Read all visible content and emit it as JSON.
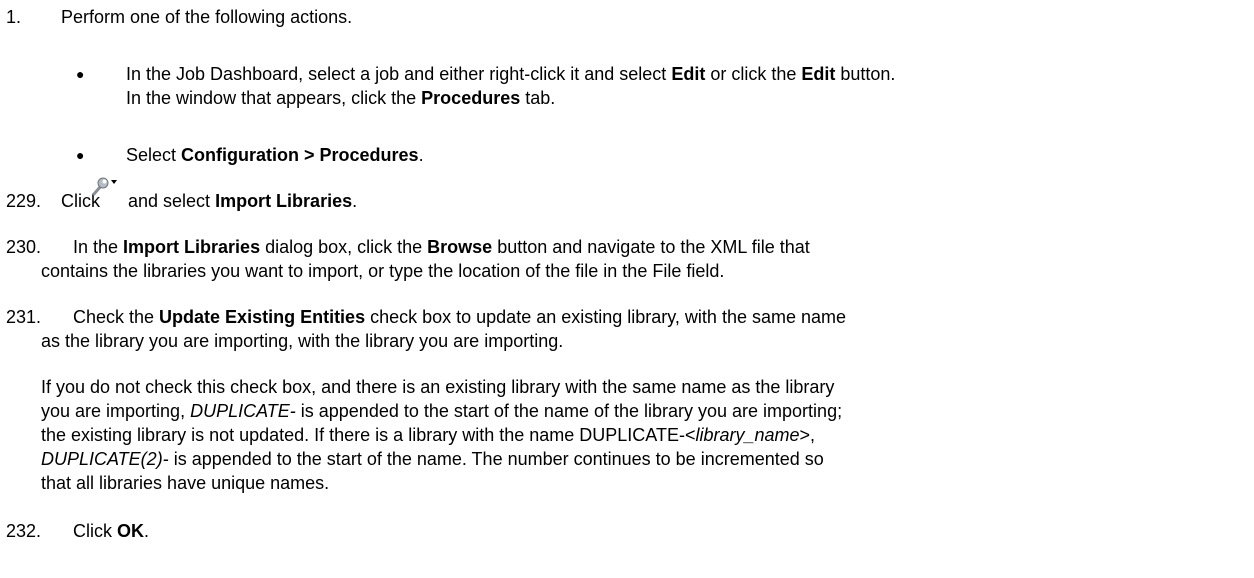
{
  "steps": {
    "s1": {
      "number": "1.",
      "text": "Perform one of the following actions.",
      "bullets": {
        "b1": {
          "line1": {
            "t1": "In the Job Dashboard, select a job and either right-click it and select ",
            "b1": "Edit",
            "t2": " or click the ",
            "b2": "Edit",
            "t3": " button."
          },
          "line2": {
            "t1": "In the window that appears, click the ",
            "b1": "Procedures",
            "t2": " tab."
          }
        },
        "b2": {
          "t1": "Select ",
          "b1": "Configuration > Procedures",
          "t2": "."
        }
      }
    },
    "s229": {
      "number": "229.",
      "t1": "Click",
      "t2": " and select ",
      "b1": "Import Libraries",
      "t3": "."
    },
    "s230": {
      "number": "230.",
      "line1": {
        "t1": "In the ",
        "b1": "Import Libraries",
        "t2": " dialog box, click the ",
        "b2": "Browse",
        "t3": " button and navigate to the XML file that"
      },
      "line2": "contains the libraries you want to import,   or type the location of the file in the File field."
    },
    "s231": {
      "number": "231.",
      "line1": {
        "t1": "Check the ",
        "b1": "Update Existing Entities",
        "t2": " check box to update an existing library, with the same name"
      },
      "line2": "as   the library you are importing, with the library you are importing.",
      "para": {
        "line1": "If you do not check this check box, and there is an existing library with the same name as the library",
        "line2": {
          "t1": "you are importing, ",
          "i1": "DUPLICATE-",
          "t2": " is appended to the start of the name of the library you are importing;"
        },
        "line3": {
          "t1": "the existing library is not updated. If there is a library with the name DUPLICATE-<",
          "i1": "library_name",
          "t2": ">,"
        },
        "line4": {
          "i1": "DUPLICATE(2)-",
          "t1": " is appended to the start of the name. The number continues to be incremented so"
        },
        "line5": "that all libraries have unique names."
      }
    },
    "s232": {
      "number": "232.",
      "t1": "Click ",
      "b1": "OK",
      "t2": "."
    }
  },
  "icons": {
    "tools_dropdown": "wrench-dropdown-icon"
  },
  "colors": {
    "text": "#000000",
    "background": "#ffffff"
  }
}
